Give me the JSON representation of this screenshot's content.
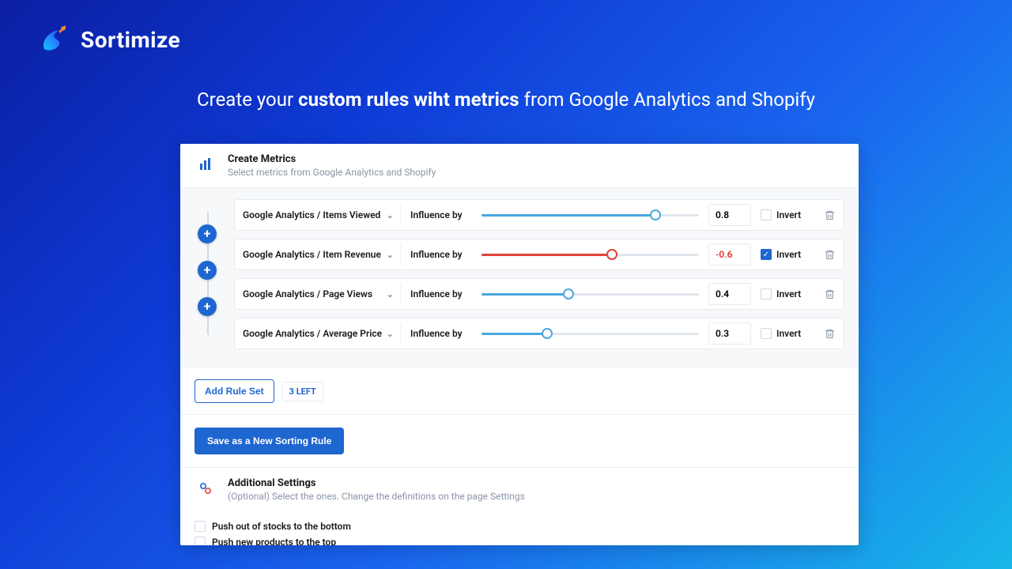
{
  "brand": {
    "name": "Sortimize"
  },
  "headline": {
    "prefix": "Create your ",
    "bold": "custom rules wiht metrics",
    "suffix": " from Google Analytics and Shopify"
  },
  "create_metrics": {
    "title": "Create Metrics",
    "subtitle": "Select metrics from Google Analytics and Shopify"
  },
  "rules": [
    {
      "metric": "Google Analytics / Items Viewed",
      "label": "Influence by",
      "value": "0.8",
      "pct": 80,
      "color": "blue",
      "invert": false,
      "invert_label": "Invert"
    },
    {
      "metric": "Google Analytics / Item Revenue",
      "label": "Influence by",
      "value": "-0.6",
      "pct": 60,
      "color": "red",
      "invert": true,
      "invert_label": "Invert"
    },
    {
      "metric": "Google Analytics / Page Views",
      "label": "Influence by",
      "value": "0.4",
      "pct": 40,
      "color": "blue",
      "invert": false,
      "invert_label": "Invert"
    },
    {
      "metric": "Google Analytics / Average Price",
      "label": "Influence by",
      "value": "0.3",
      "pct": 30,
      "color": "blue",
      "invert": false,
      "invert_label": "Invert"
    }
  ],
  "add_rule": {
    "button": "Add Rule Set",
    "remaining_badge": "3 LEFT"
  },
  "save": {
    "button": "Save as a New Sorting Rule"
  },
  "additional": {
    "title": "Additional Settings",
    "subtitle": "(Optional) Select the ones. Change the definitions on the page Settings",
    "options": [
      {
        "label": "Push out of stocks to the bottom",
        "checked": false
      },
      {
        "label": "Push new products to the top",
        "checked": false
      }
    ]
  },
  "icons": {
    "plus": "+",
    "check": "✓"
  }
}
